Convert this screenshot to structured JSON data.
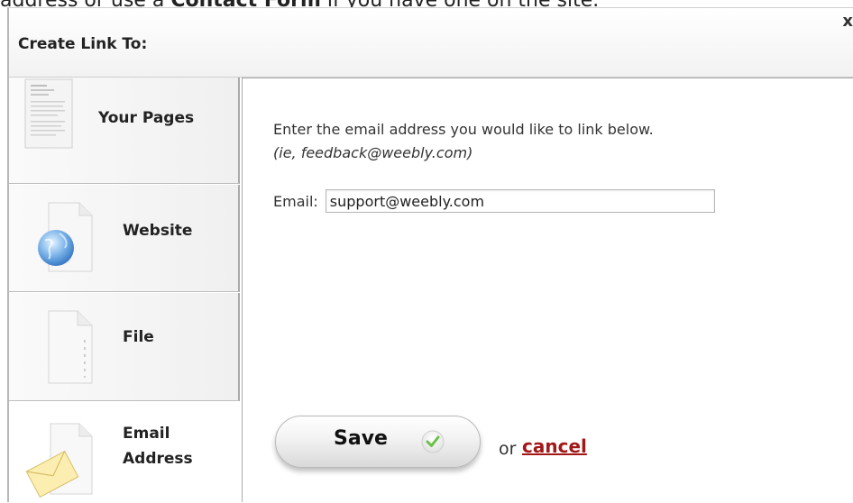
{
  "background_text": {
    "prefix": "address or use a ",
    "link": "Contact Form",
    "suffix": " if you have one on the site."
  },
  "dialog": {
    "title": "Create Link To:",
    "close_label": "x"
  },
  "sidebar": {
    "items": [
      {
        "label": "Your Pages",
        "icon": "pages-icon",
        "selected": false
      },
      {
        "label": "Website",
        "icon": "globe-icon",
        "selected": false
      },
      {
        "label": "File",
        "icon": "file-icon",
        "selected": false
      },
      {
        "label_line1": "Email",
        "label_line2": "Address",
        "icon": "envelope-icon",
        "selected": true
      }
    ]
  },
  "content": {
    "instruction": "Enter the email address you would like to link below.",
    "example": "(ie, feedback@weebly.com)",
    "email_label": "Email:",
    "email_value": "support@weebly.com"
  },
  "actions": {
    "save_label": "Save",
    "or_label": "or",
    "cancel_label": "cancel"
  },
  "colors": {
    "cancel_link": "#a21818",
    "check_green": "#6cc04a"
  }
}
